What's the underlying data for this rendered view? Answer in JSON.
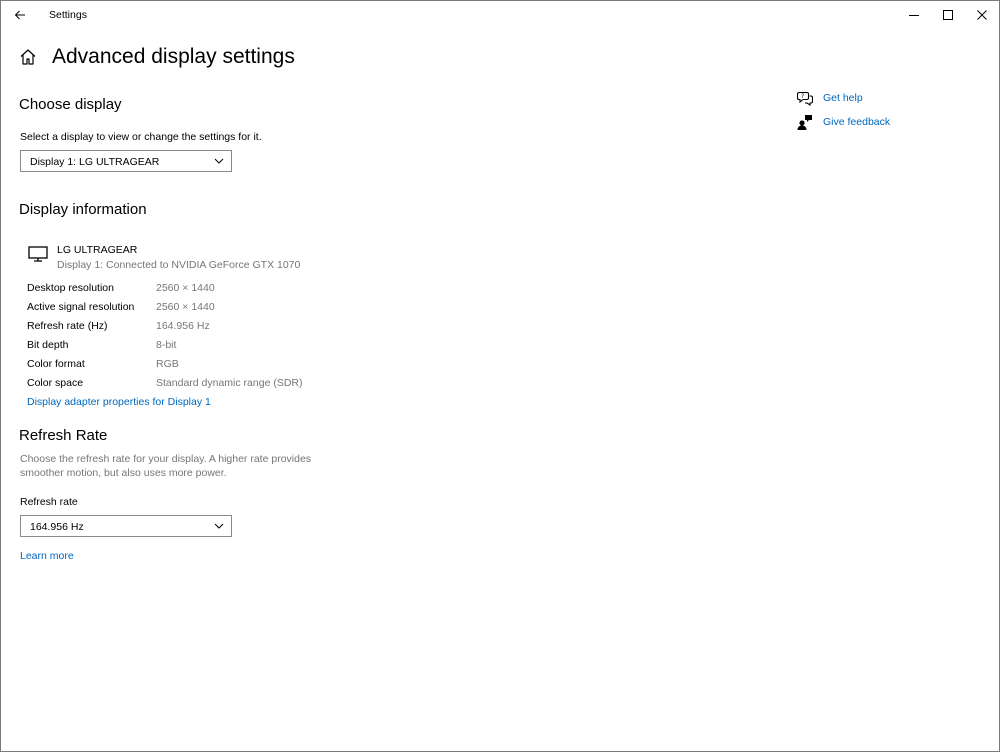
{
  "titlebar": {
    "app_title": "Settings",
    "back_icon": "back-arrow-icon",
    "minimize_icon": "minimize-icon",
    "maximize_icon": "maximize-icon",
    "close_icon": "close-icon"
  },
  "header": {
    "home_icon": "home-icon",
    "title": "Advanced display settings"
  },
  "choose_display": {
    "title": "Choose display",
    "description": "Select a display to view or change the settings for it.",
    "selected": "Display 1: LG ULTRAGEAR"
  },
  "display_information": {
    "title": "Display information",
    "monitor_icon": "monitor-icon",
    "monitor_name": "LG ULTRAGEAR",
    "connection": "Display 1: Connected to NVIDIA GeForce GTX 1070",
    "rows": [
      {
        "label": "Desktop resolution",
        "value": "2560 × 1440"
      },
      {
        "label": "Active signal resolution",
        "value": "2560 × 1440"
      },
      {
        "label": "Refresh rate (Hz)",
        "value": "164.956 Hz"
      },
      {
        "label": "Bit depth",
        "value": "8-bit"
      },
      {
        "label": "Color format",
        "value": "RGB"
      },
      {
        "label": "Color space",
        "value": "Standard dynamic range (SDR)"
      }
    ],
    "adapter_link": "Display adapter properties for Display 1"
  },
  "refresh_rate": {
    "title": "Refresh Rate",
    "description_line1": "Choose the refresh rate for your display. A higher rate provides",
    "description_line2": "smoother motion, but also uses more power.",
    "field_label": "Refresh rate",
    "selected": "164.956 Hz",
    "learn_more": "Learn more"
  },
  "side_panel": {
    "get_help": "Get help",
    "give_feedback": "Give feedback"
  },
  "colors": {
    "link": "#0067c0",
    "muted_text": "#767676",
    "border": "#8a8a8a"
  }
}
